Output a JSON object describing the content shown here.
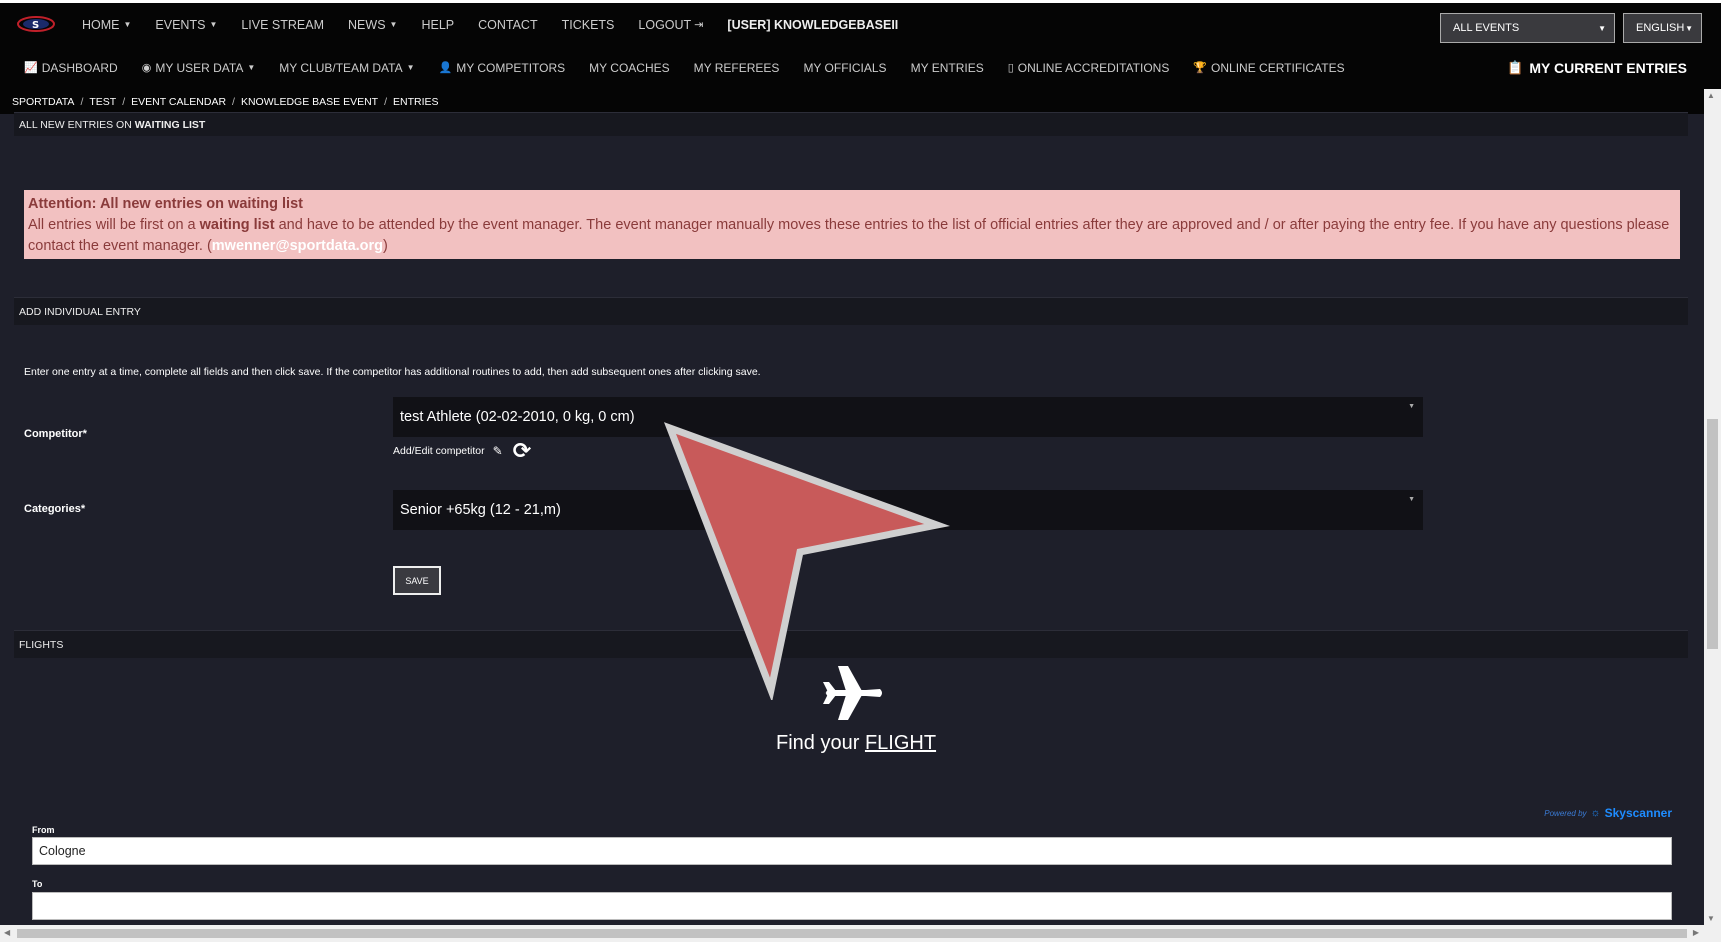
{
  "topnav": {
    "items": [
      {
        "label": "HOME",
        "dropdown": true
      },
      {
        "label": "EVENTS",
        "dropdown": true
      },
      {
        "label": "LIVE STREAM"
      },
      {
        "label": "NEWS",
        "dropdown": true
      },
      {
        "label": "HELP"
      },
      {
        "label": "CONTACT"
      },
      {
        "label": "TICKETS"
      },
      {
        "label": "LOGOUT"
      },
      {
        "label": "[USER] KNOWLEDGEBASEII"
      }
    ],
    "events_select": "ALL EVENTS",
    "language_select": "ENGLISH"
  },
  "subnav": {
    "items": [
      {
        "label": "DASHBOARD",
        "icon": "chart-icon"
      },
      {
        "label": "MY USER DATA",
        "icon": "user-circle-icon",
        "dropdown": true
      },
      {
        "label": "MY CLUB/TEAM DATA",
        "dropdown": true
      },
      {
        "label": "MY COMPETITORS",
        "icon": "user-icon"
      },
      {
        "label": "MY COACHES"
      },
      {
        "label": "MY REFEREES"
      },
      {
        "label": "MY OFFICIALS"
      },
      {
        "label": "MY ENTRIES"
      },
      {
        "label": "ONLINE ACCREDITATIONS",
        "icon": "badge-icon"
      },
      {
        "label": "ONLINE CERTIFICATES",
        "icon": "trophy-icon"
      }
    ],
    "current_entries": "MY CURRENT ENTRIES"
  },
  "breadcrumb": [
    "SPORTDATA",
    "TEST",
    "EVENT CALENDAR",
    "KNOWLEDGE BASE EVENT",
    "ENTRIES"
  ],
  "waiting_header": {
    "prefix": "ALL NEW ENTRIES ON ",
    "bold": "WAITING LIST"
  },
  "alert": {
    "title": "Attention: All new entries on waiting list",
    "text1": "All entries will be first on a ",
    "bold": "waiting list",
    "text2": " and have to be attended by the event manager. The event manager manually moves these entries to the list of official entries after they are approved and / or after paying the entry fee. If you have any questions please contact the event manager.  (",
    "email": "mwenner@sportdata.org",
    "text3": ")"
  },
  "add_entry": {
    "header": "ADD INDIVIDUAL ENTRY",
    "instructions": "Enter one entry at a time, complete all fields and then click save. If the competitor has additional routines to add, then add subsequent ones after clicking save.",
    "competitor_label": "Competitor*",
    "competitor_value": "test Athlete (02-02-2010, 0 kg, 0 cm)",
    "add_edit_label": "Add/Edit competitor",
    "categories_label": "Categories*",
    "categories_value": "Senior +65kg (12 - 21,m)",
    "save_label": "SAVE"
  },
  "flights": {
    "header": "FLIGHTS",
    "find_prefix": "Find your ",
    "find_link": "FLIGHT",
    "powered_by": "Powered by",
    "brand": "Skyscanner",
    "from_label": "From",
    "from_value": "Cologne",
    "to_label": "To",
    "to_value": ""
  }
}
